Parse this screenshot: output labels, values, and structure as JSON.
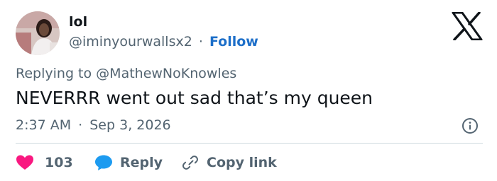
{
  "user": {
    "name": "lol",
    "handle": "@iminyourwallsx2",
    "separator": "·",
    "follow_label": "Follow"
  },
  "logo": {
    "icon": "x-logo-icon"
  },
  "reply_context": {
    "prefix": "Replying to",
    "mention": "@MathewNoKnowles"
  },
  "tweet": {
    "text": "NEVERRR went out sad that’s my queen"
  },
  "meta": {
    "time": "2:37 AM",
    "separator": "·",
    "date": "Sep 3, 2026",
    "info_icon": "info-icon"
  },
  "actions": {
    "likes_count": "103",
    "reply_label": "Reply",
    "copy_link_label": "Copy link"
  },
  "colors": {
    "text": "#0f1419",
    "secondary": "#536471",
    "follow": "#1d6fc9",
    "like": "#f91880",
    "reply": "#1d9bf0",
    "divider": "#cfd9de"
  }
}
